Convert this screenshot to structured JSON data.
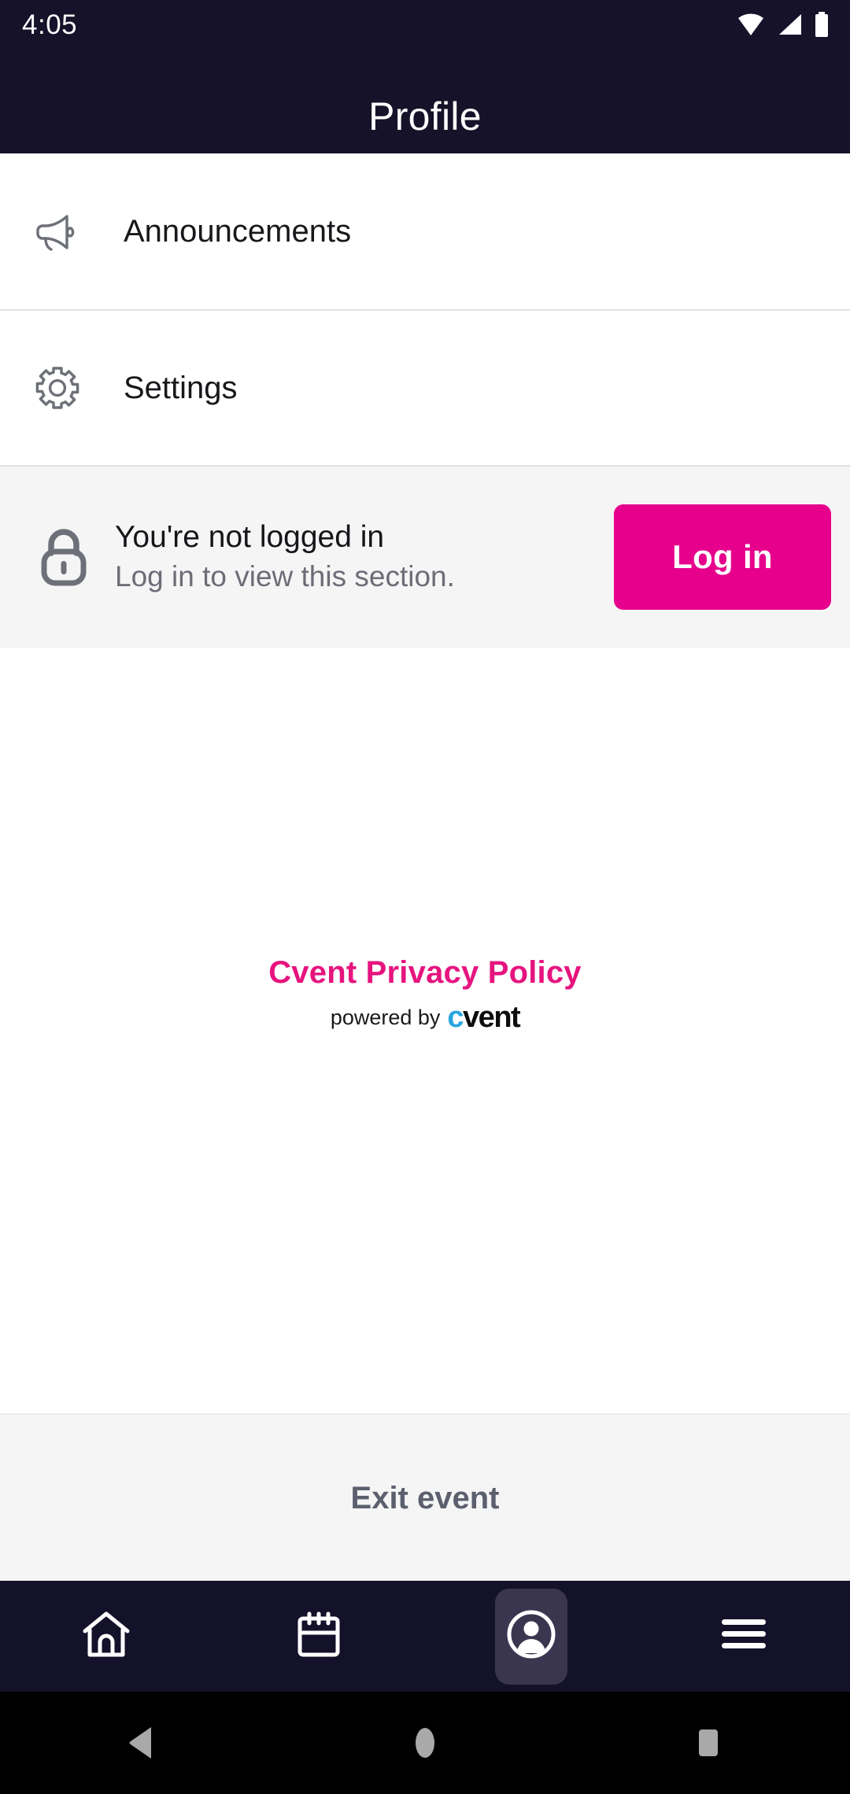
{
  "status_bar": {
    "time": "4:05",
    "icons": [
      "wifi-icon",
      "cellular-signal-icon",
      "battery-icon"
    ]
  },
  "header": {
    "title": "Profile",
    "background": "#151229"
  },
  "menu": {
    "items": [
      {
        "label": "Announcements",
        "icon": "megaphone-icon"
      },
      {
        "label": "Settings",
        "icon": "gear-icon"
      }
    ]
  },
  "login_banner": {
    "icon": "lock-icon",
    "title": "You're not logged in",
    "subtitle": "Log in to view this section.",
    "button_label": "Log in",
    "button_color": "#e6008c",
    "background": "#f5f5f6"
  },
  "footer": {
    "privacy_link": "Cvent Privacy Policy",
    "privacy_color": "#e6147f",
    "powered_by_text": "powered by",
    "brand_c": "c",
    "brand_rest": "vent",
    "brand_c_color": "#29a5df"
  },
  "exit": {
    "label": "Exit event"
  },
  "tabs": [
    {
      "name": "home",
      "icon": "home-icon",
      "active": false
    },
    {
      "name": "schedule",
      "icon": "calendar-icon",
      "active": false
    },
    {
      "name": "profile",
      "icon": "person-circle-icon",
      "active": true
    },
    {
      "name": "more",
      "icon": "hamburger-menu-icon",
      "active": false
    }
  ],
  "android_nav": {
    "buttons": [
      "back-triangle-icon",
      "home-circle-icon",
      "recents-square-icon"
    ]
  }
}
